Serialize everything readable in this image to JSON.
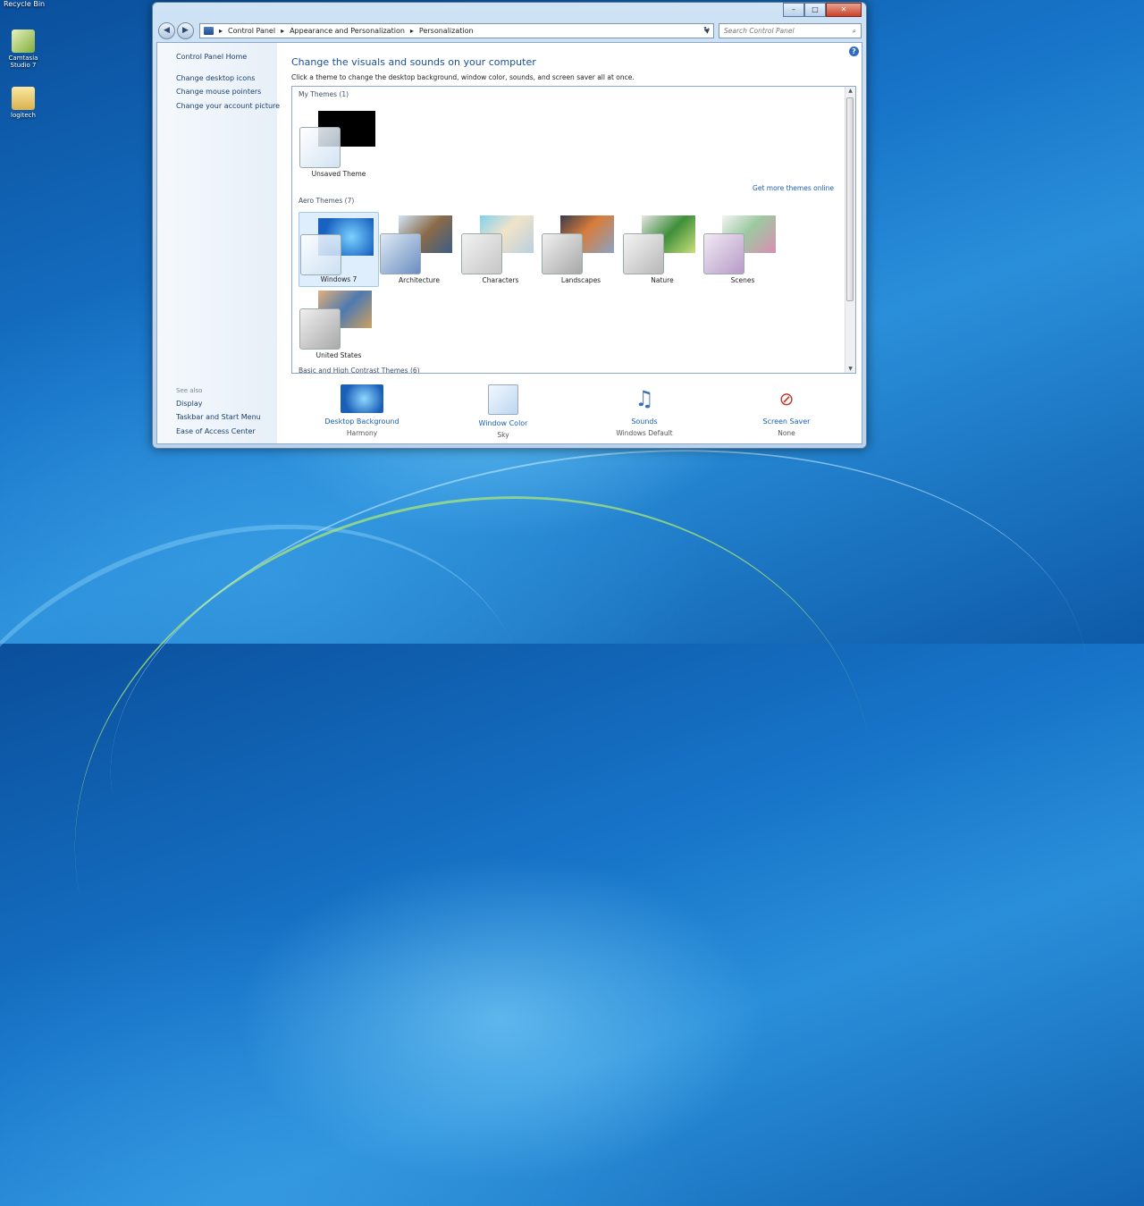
{
  "desktop": {
    "recycle_bin": "Recycle Bin",
    "icons": [
      {
        "label": "Camtasia Studio 7",
        "icon": "camtasia-icon"
      },
      {
        "label": "logitech",
        "icon": "folder-icon"
      }
    ]
  },
  "window": {
    "controls": {
      "minimize": "–",
      "maximize": "□",
      "close": "✕"
    },
    "breadcrumb": [
      "Control Panel",
      "Appearance and Personalization",
      "Personalization"
    ],
    "search_placeholder": "Search Control Panel"
  },
  "left_pane": {
    "links": [
      "Control Panel Home",
      "Change desktop icons",
      "Change mouse pointers",
      "Change your account picture"
    ],
    "see_also_label": "See also",
    "see_also": [
      "Display",
      "Taskbar and Start Menu",
      "Ease of Access Center"
    ]
  },
  "main": {
    "heading": "Change the visuals and sounds on your computer",
    "subheading": "Click a theme to change the desktop background, window color, sounds, and screen saver all at once.",
    "get_more": "Get more themes online",
    "groups": {
      "my_themes": "My Themes (1)",
      "aero_themes": "Aero Themes (7)",
      "basic": "Basic and High Contrast Themes (6)"
    },
    "my_themes": [
      {
        "label": "Unsaved Theme"
      }
    ],
    "aero_themes": [
      {
        "label": "Windows 7",
        "selected": true
      },
      {
        "label": "Architecture"
      },
      {
        "label": "Characters"
      },
      {
        "label": "Landscapes"
      },
      {
        "label": "Nature"
      },
      {
        "label": "Scenes"
      },
      {
        "label": "United States"
      }
    ]
  },
  "bottom": [
    {
      "name": "Desktop Background",
      "value": "Harmony",
      "icon": "desktop-background-icon"
    },
    {
      "name": "Window Color",
      "value": "Sky",
      "icon": "window-color-icon"
    },
    {
      "name": "Sounds",
      "value": "Windows Default",
      "icon": "sounds-icon"
    },
    {
      "name": "Screen Saver",
      "value": "None",
      "icon": "screen-saver-icon"
    }
  ]
}
